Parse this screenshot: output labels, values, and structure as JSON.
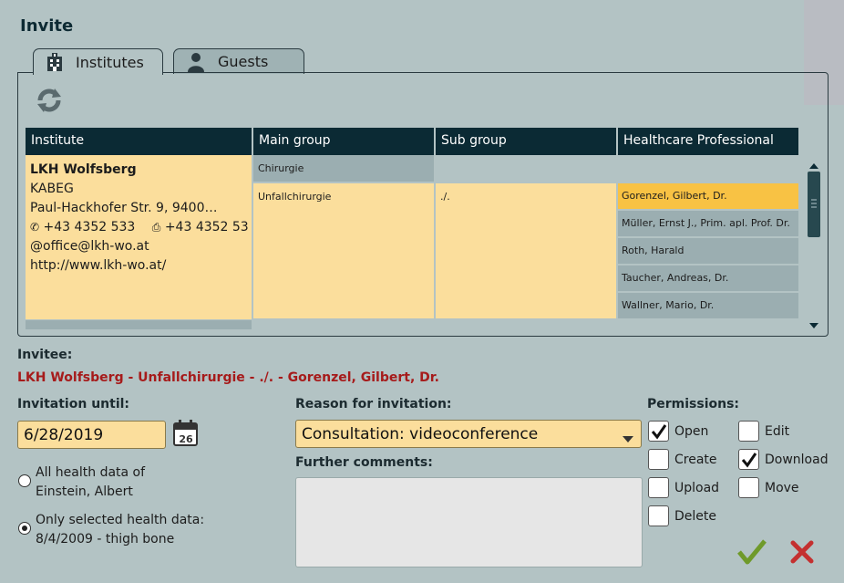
{
  "title": "Invite",
  "tabs": [
    {
      "label": "Institutes",
      "icon": "building-icon",
      "active": true
    },
    {
      "label": "Guests",
      "icon": "person-icon",
      "active": false
    }
  ],
  "table": {
    "headers": [
      "Institute",
      "Main group",
      "Sub group",
      "Healthcare Professional"
    ],
    "institute": {
      "name": "LKH Wolfsberg",
      "org": "KABEG",
      "street": "Paul-Hackhofer Str. 9, 9400…",
      "phone": "+43 4352 533",
      "fax": "+43 4352 53",
      "email": "office@lkh-wo.at",
      "web": "http://www.lkh-wo.at/"
    },
    "main_groups": [
      "Chirurgie",
      "Unfallchirurgie"
    ],
    "sub_group": "./.",
    "professionals": [
      {
        "name": "Gorenzel, Gilbert, Dr.",
        "selected": true
      },
      {
        "name": "Müller, Ernst J., Prim. apl. Prof. Dr.",
        "selected": false
      },
      {
        "name": "Roth, Harald",
        "selected": false
      },
      {
        "name": "Taucher, Andreas, Dr.",
        "selected": false
      },
      {
        "name": "Wallner, Mario, Dr.",
        "selected": false
      }
    ]
  },
  "invitee": {
    "label": "Invitee:",
    "value": "LKH Wolfsberg - Unfallchirurgie - ./. - Gorenzel, Gilbert, Dr."
  },
  "invitation_until": {
    "label": "Invitation until:",
    "value": "6/28/2019",
    "calendar_day": "26"
  },
  "health_data": {
    "all_label_line1": "All health data of",
    "all_label_line2": "Einstein, Albert",
    "selected_label_line1": "Only selected health data:",
    "selected_label_line2": "8/4/2009 - thigh  bone",
    "selected_option": "selected"
  },
  "reason": {
    "label": "Reason for invitation:",
    "value": "Consultation: videoconference"
  },
  "comments": {
    "label": "Further comments:",
    "value": ""
  },
  "permissions": {
    "label": "Permissions:",
    "items": [
      {
        "label": "Open",
        "checked": true
      },
      {
        "label": "Edit",
        "checked": false
      },
      {
        "label": "Create",
        "checked": false
      },
      {
        "label": "Download",
        "checked": true
      },
      {
        "label": "Upload",
        "checked": false
      },
      {
        "label": "Move",
        "checked": false
      },
      {
        "label": "Delete",
        "checked": false
      }
    ]
  },
  "colors": {
    "header_bg": "#0b2a34",
    "cell_yellow": "#fbde9c",
    "selected_orange": "#f8c244",
    "invitee_red": "#a61b1b",
    "confirm_green": "#6f9a2a",
    "cancel_red": "#c43030"
  }
}
